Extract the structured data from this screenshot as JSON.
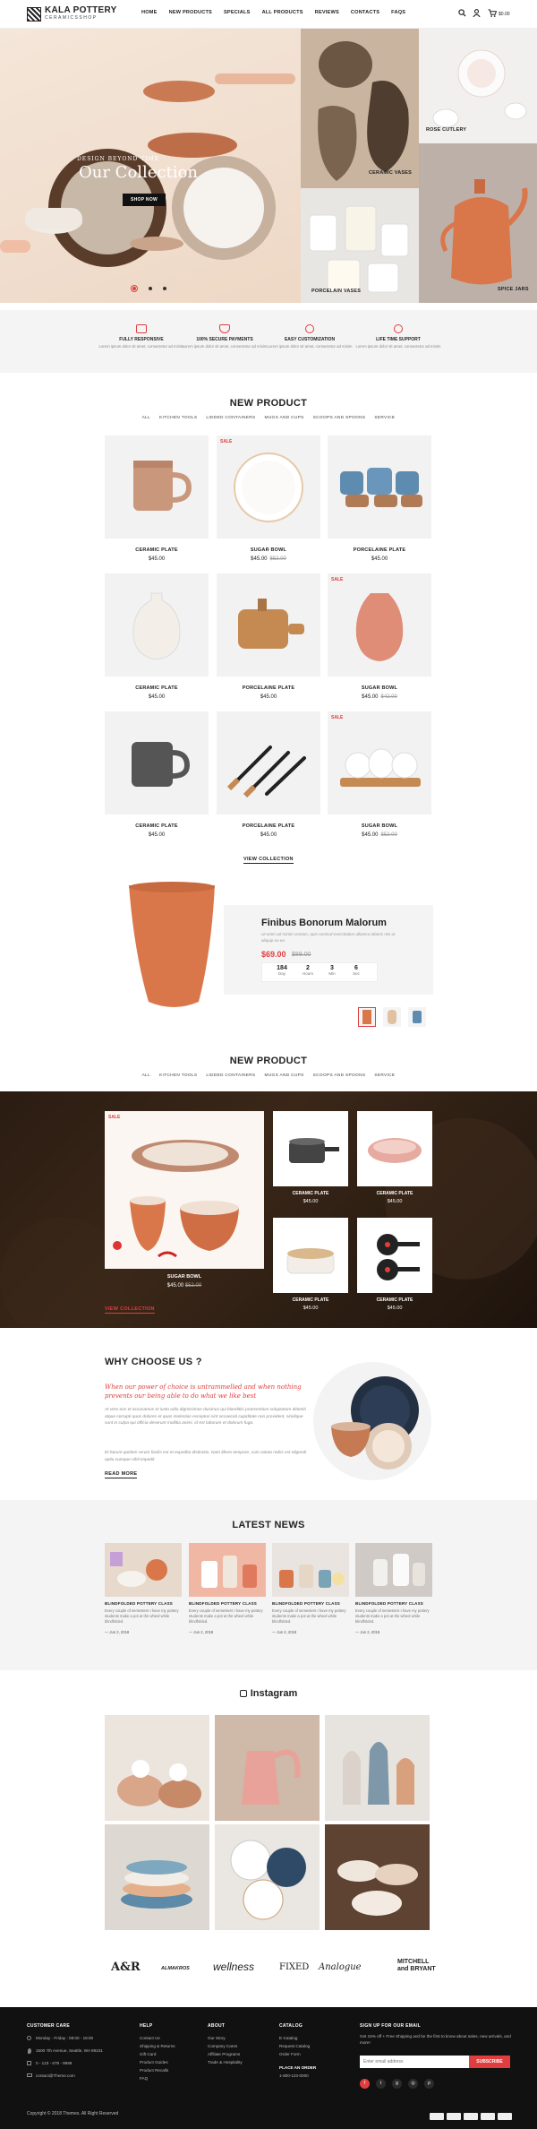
{
  "header": {
    "logo_title": "KALA POTTERY",
    "logo_sub": "CERAMICSSHOP",
    "nav": [
      "HOME",
      "NEW PRODUCTS",
      "SPECIALS",
      "ALL PRODUCTS",
      "REVIEWS",
      "CONTACTS",
      "FAQS"
    ],
    "cart_total": "$0.00"
  },
  "hero": {
    "eyebrow": "DESIGN BEYOND TIME",
    "title": "Our Collection",
    "button": "SHOP NOW",
    "tiles": [
      "ROSE CUTLERY",
      "CERAMIC VASES",
      "PORCELAIN VASES",
      "SPICE JARS"
    ]
  },
  "features": [
    {
      "title": "FULLY RESPONSIVE",
      "desc": "Lorem ipsum dolor sit amet, consectetur ad minim"
    },
    {
      "title": "100% SECURE PAYMENTS",
      "desc": "Lorem ipsum dolor sit amet, consectetur ad minim"
    },
    {
      "title": "EASY CUSTOMIZATION",
      "desc": "Lorem ipsum dolor sit amet, consectetur ad minim"
    },
    {
      "title": "LIFE TIME SUPPORT",
      "desc": "Lorem ipsum dolor sit amet, consectetur ad minim"
    }
  ],
  "new_product": {
    "title": "NEW PRODUCT",
    "tabs": [
      "ALL",
      "KITCHEN TOOLS",
      "LIDDED CONTAINERS",
      "MUGS AND CUPS",
      "SCOOPS AND SPOONS",
      "SERVICE"
    ],
    "sale_label": "SALE",
    "products": [
      {
        "name": "CERAMIC PLATE",
        "price": "$45.00",
        "old": ""
      },
      {
        "name": "SUGAR BOWL",
        "price": "$45.00",
        "old": "$52.00"
      },
      {
        "name": "PORCELAINE PLATE",
        "price": "$45.00",
        "old": ""
      },
      {
        "name": "CERAMIC PLATE",
        "price": "$45.00",
        "old": ""
      },
      {
        "name": "PORCELAINE PLATE",
        "price": "$45.00",
        "old": ""
      },
      {
        "name": "SUGAR BOWL",
        "price": "$45.00",
        "old": "$42.00"
      },
      {
        "name": "CERAMIC PLATE",
        "price": "$45.00",
        "old": ""
      },
      {
        "name": "PORCELAINE PLATE",
        "price": "$45.00",
        "old": ""
      },
      {
        "name": "SUGAR BOWL",
        "price": "$45.00",
        "old": "$52.00"
      }
    ],
    "view_collection": "VIEW COLLECTION"
  },
  "deal": {
    "title": "Finibus Bonorum Malorum",
    "desc": "Ut enim ad minim veniam, quis nostrud exercitation ullamco laboris nisi ut aliquip ex ea",
    "price": "$69.00",
    "old": "$89.00",
    "countdown": [
      {
        "n": "184",
        "l": "Day"
      },
      {
        "n": "2",
        "l": "Hours"
      },
      {
        "n": "3",
        "l": "Min"
      },
      {
        "n": "6",
        "l": "Sec"
      }
    ]
  },
  "new_product2": {
    "title": "NEW PRODUCT",
    "tabs": [
      "ALL",
      "KITCHEN TOOLS",
      "LIDDED CONTAINERS",
      "MUGS AND CUPS",
      "SCOOPS AND SPOONS",
      "SERVICE"
    ],
    "big": {
      "name": "SUGAR BOWL",
      "price": "$45.00",
      "old": "$52.00"
    },
    "small": [
      {
        "name": "CERAMIC PLATE",
        "price": "$45.00"
      },
      {
        "name": "CERAMIC PLATE",
        "price": "$45.00"
      },
      {
        "name": "CERAMIC PLATE",
        "price": "$45.00"
      },
      {
        "name": "CERAMIC PLATE",
        "price": "$45.00"
      }
    ],
    "view_collection": "VIEW COLLECTION"
  },
  "why": {
    "title": "WHY CHOOSE US ?",
    "quote": "When our power of choice is untrammelled and when nothing prevents our being able to do what we like best",
    "para1": "At vero eos et accusamus et iusto odio dignissimos ducimus qui blanditiis praesentium voluptatum deleniti atque corrupti quos dolores et quas molestias excepturi sint occaecati cupiditate non provident, similique sunt in culpa qui officia deserunt mollitia animi, id est laborum et dolorum fuga.",
    "para2": "Et harum quidem rerum facilis est et expedita distinctio. Nam libero tempore, cum soluta nobis est eligendi optio cumque nihil impedit",
    "read_more": "READ MORE"
  },
  "news": {
    "title": "LATEST NEWS",
    "items": [
      {
        "title": "BLINDFOLDED POTTERY CLASS",
        "desc": "Every couple of semesters I have my pottery students make a pot at the wheel while blindfolded.",
        "date": "Jun 2, 2018"
      },
      {
        "title": "BLINDFOLDED POTTERY CLASS",
        "desc": "Every couple of semesters I have my pottery students make a pot at the wheel while blindfolded.",
        "date": "Jun 2, 2018"
      },
      {
        "title": "BLINDFOLDED POTTERY CLASS",
        "desc": "Every couple of semesters I have my pottery students make a pot at the wheel while blindfolded.",
        "date": "Jun 2, 2018"
      },
      {
        "title": "BLINDFOLDED POTTERY CLASS",
        "desc": "Every couple of semesters I have my pottery students make a pot at the wheel while blindfolded.",
        "date": "Jun 2, 2018"
      }
    ]
  },
  "instagram": {
    "title": "Instagram"
  },
  "brands": [
    "A&R",
    "ALMAKROS",
    "wellness",
    "FIXED",
    "Analogue",
    "MITCHELL and BRYANT"
  ],
  "footer": {
    "cols": [
      {
        "title": "CUSTOMER CARE",
        "items": [
          "Monday - Friday : 08:00 - 18:00",
          "1500 7th Avenue, Seattle, WA 98101",
          "0 - 123 - 678 - 9999",
          "contact@Theme.com"
        ]
      },
      {
        "title": "HELP",
        "items": [
          "Contact Us",
          "Shipping & Returns",
          "Gift Card",
          "Product Guides",
          "Product Recalls",
          "FAQ"
        ]
      },
      {
        "title": "ABOUT",
        "items": [
          "Our Story",
          "Company Cares",
          "Affiliate Programs",
          "Trade & Hospitality"
        ]
      },
      {
        "title": "CATALOG",
        "items": [
          "E-Catalog",
          "Request Catalog",
          "Order Form",
          "PLACE AN ORDER",
          "1-800-123-0000"
        ]
      }
    ],
    "signup_title": "SIGN UP FOR OUR EMAIL",
    "signup_desc": "Get 15% off + Free Shipping and be the first to know about sales, new arrivals, and more!",
    "email_placeholder": "Enter email address",
    "subscribe": "SUBSCRIBE",
    "copyright": "Copyright © 2018 Themes. All Right Reserved",
    "social_icons": [
      "facebook",
      "twitter",
      "google",
      "instagram",
      "pinterest"
    ]
  },
  "colors": {
    "accent": "#e03e3e",
    "dark": "#111111",
    "terracotta": "#d9774b"
  }
}
